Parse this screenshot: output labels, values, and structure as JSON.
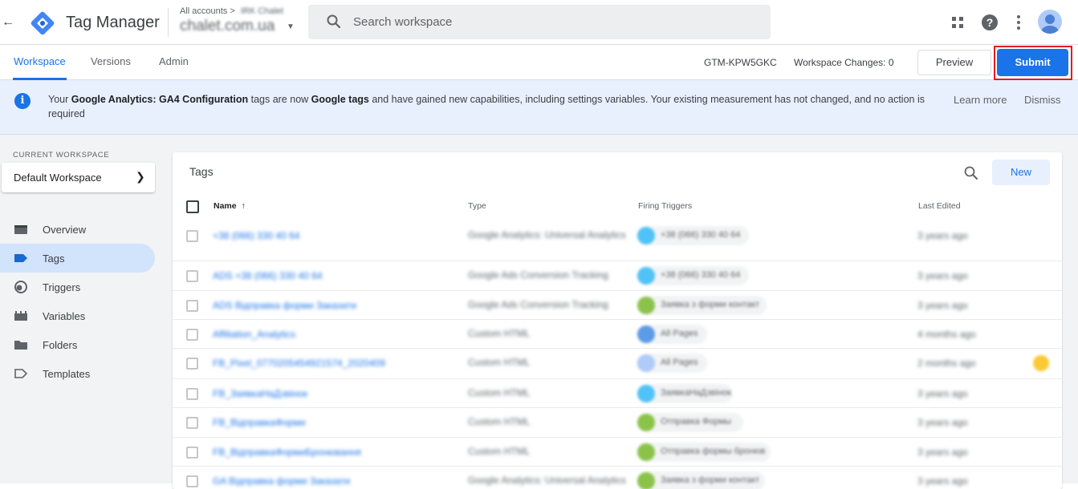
{
  "header": {
    "app_title": "Tag Manager",
    "breadcrumb_prefix": "All accounts",
    "breadcrumb_separator": ">",
    "account_name": "IRK Chalet",
    "container_name": "chalet.com.ua",
    "search_placeholder": "Search workspace"
  },
  "subnav": {
    "tabs": [
      {
        "label": "Workspace",
        "active": true
      },
      {
        "label": "Versions",
        "active": false
      },
      {
        "label": "Admin",
        "active": false
      }
    ],
    "container_id": "GTM-KPW5GKC",
    "workspace_changes_label": "Workspace Changes: 0",
    "preview_label": "Preview",
    "submit_label": "Submit"
  },
  "banner": {
    "text_1": "Your ",
    "bold_1": "Google Analytics: GA4 Configuration",
    "text_2": " tags are now ",
    "bold_2": "Google tags",
    "text_3": " and have gained new capabilities, including settings variables. Your existing measurement has not changed, and no action is required",
    "learn_more": "Learn more",
    "dismiss": "Dismiss"
  },
  "sidebar": {
    "current_workspace_label": "CURRENT WORKSPACE",
    "workspace_name": "Default Workspace",
    "items": [
      {
        "label": "Overview",
        "icon": "overview-icon",
        "active": false
      },
      {
        "label": "Tags",
        "icon": "tag-icon",
        "active": true
      },
      {
        "label": "Triggers",
        "icon": "trigger-icon",
        "active": false
      },
      {
        "label": "Variables",
        "icon": "variables-icon",
        "active": false
      },
      {
        "label": "Folders",
        "icon": "folder-icon",
        "active": false
      },
      {
        "label": "Templates",
        "icon": "template-icon",
        "active": false
      }
    ]
  },
  "tags_table": {
    "title": "Tags",
    "new_label": "New",
    "columns": {
      "name": "Name",
      "type": "Type",
      "triggers": "Firing Triggers",
      "last_edited": "Last Edited"
    },
    "rows": [
      {
        "name": "+38 (066) 330 40 64",
        "type": "Google Analytics: Universal Analytics",
        "trigger": "+38 (066) 330 40 64",
        "trigger_color": "#4fc3f7",
        "edited": "3 years ago"
      },
      {
        "name": "ADS +38 (066) 330 40 64",
        "type": "Google Ads Conversion Tracking",
        "trigger": "+38 (066) 330 40 64",
        "trigger_color": "#4fc3f7",
        "edited": "3 years ago"
      },
      {
        "name": "ADS Відправка форми Заказати",
        "type": "Google Ads Conversion Tracking",
        "trigger": "Заявка з форми контакт",
        "trigger_color": "#8bc34a",
        "edited": "3 years ago"
      },
      {
        "name": "Affiliation_Analytics",
        "type": "Custom HTML",
        "trigger": "All Pages",
        "trigger_color": "#5c9ce6",
        "edited": "4 months ago"
      },
      {
        "name": "FB_Pixel_0770205454921574_2020409",
        "type": "Custom HTML",
        "trigger": "All Pages",
        "trigger_color": "#aecbfa",
        "edited": "2 months ago"
      },
      {
        "name": "FB_ЗаявкаНаДзвінок",
        "type": "Custom HTML",
        "trigger": "ЗаявкаНаДзвінок",
        "trigger_color": "#4fc3f7",
        "edited": "3 years ago"
      },
      {
        "name": "FB_ВідправкаФорми",
        "type": "Custom HTML",
        "trigger": "Отправка Формы",
        "trigger_color": "#8bc34a",
        "edited": "3 years ago"
      },
      {
        "name": "FB_ВідправкаФормиБронювання",
        "type": "Custom HTML",
        "trigger": "Отправка формы бронюв",
        "trigger_color": "#8bc34a",
        "edited": "3 years ago"
      },
      {
        "name": "GA Відправка форми Заказати",
        "type": "Google Analytics: Universal Analytics",
        "trigger": "Заявка з форми контакт",
        "trigger_color": "#8bc34a",
        "edited": "3 years ago"
      }
    ]
  }
}
